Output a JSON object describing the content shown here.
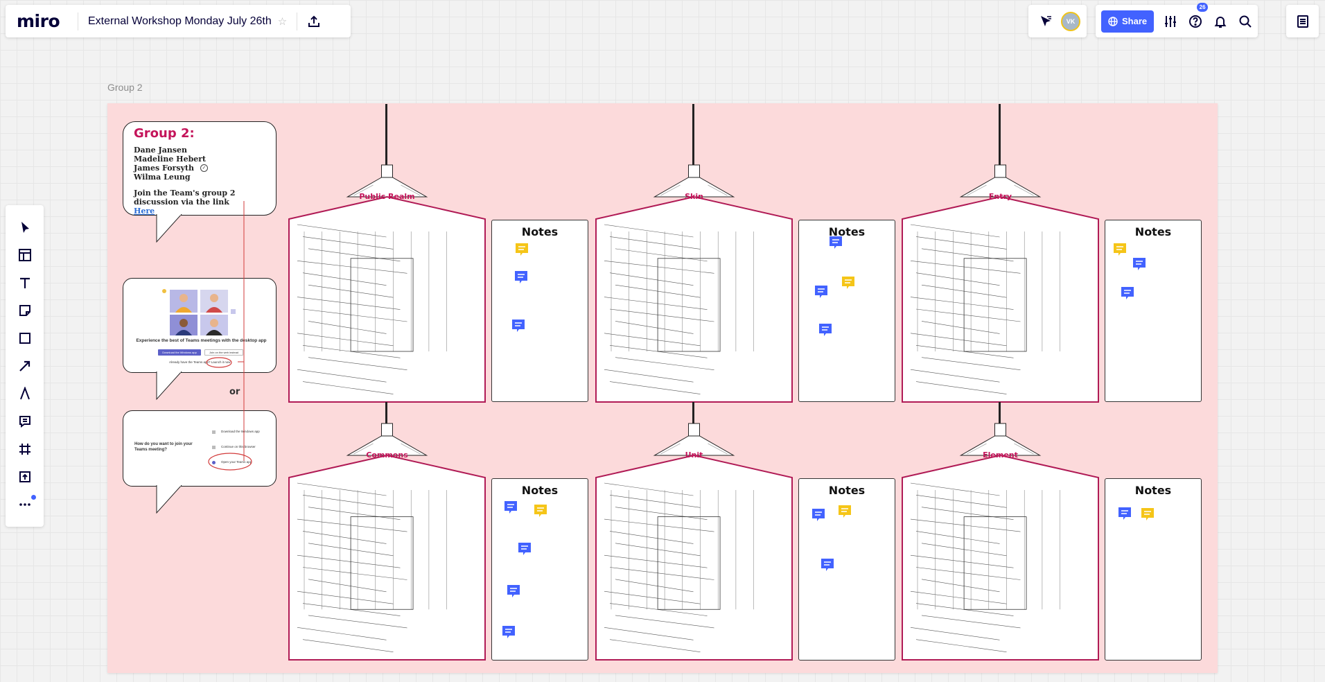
{
  "app": {
    "logo": "miro",
    "board_title": "External Workshop Monday July 26th"
  },
  "topbar": {
    "avatar_initials": "VK",
    "share_label": "Share",
    "help_badge": "26"
  },
  "toolbar": [
    "select-tool",
    "templates-tool",
    "text-tool",
    "sticky-note-tool",
    "shape-tool",
    "arrow-tool",
    "pen-tool",
    "comment-tool",
    "frame-tool",
    "upload-tool",
    "more-tools"
  ],
  "frame": {
    "label": "Group 2",
    "background": "#fcdadb"
  },
  "group_card": {
    "title": "Group 2:",
    "members": [
      "Dane Jansen",
      "Madeline Hebert",
      "James Forsyth",
      "Wilma Leung"
    ],
    "join_text": "Join the Team's group 2 discussion via the link",
    "link_label": "Here"
  },
  "teams_card": {
    "headline": "Experience the best of Teams meetings with the desktop app",
    "button_primary": "Download the Windows app",
    "button_secondary": "Join on the web instead",
    "footer": "Already have the Teams app? Launch it now"
  },
  "or_label": "or",
  "join_card": {
    "question": "How do you want to join your Teams meeting?",
    "options": [
      "Download the Windows app",
      "Continue on this browser",
      "Open your Teams app"
    ]
  },
  "houses": [
    {
      "label": "Public Realm"
    },
    {
      "label": "Skin"
    },
    {
      "label": "Entry"
    },
    {
      "label": "Commons"
    },
    {
      "label": "Unit"
    },
    {
      "label": "Element"
    }
  ],
  "notes_label": "Notes",
  "colors": {
    "accent": "#4262ff",
    "brand_pink": "#c4145a",
    "comment_blue": "#4262ff",
    "comment_yellow": "#f5c518"
  }
}
